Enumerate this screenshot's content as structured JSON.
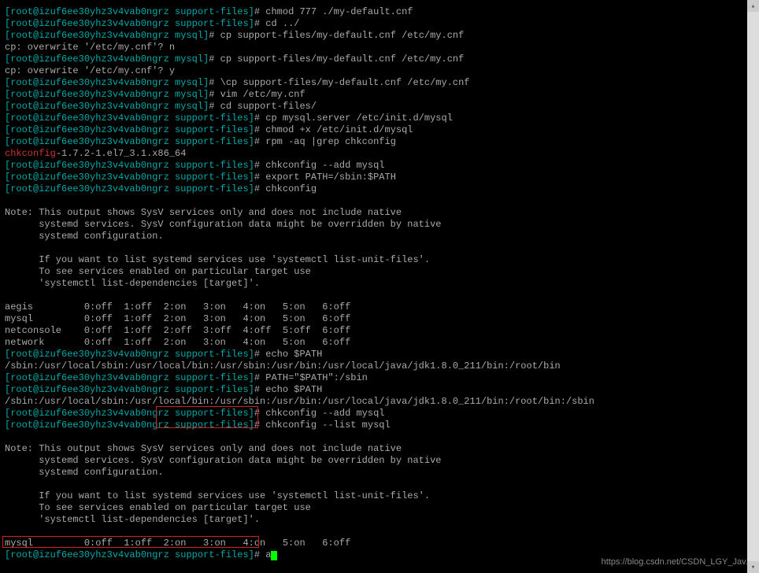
{
  "host": "izuf6ee30yhz3v4vab0ngrz",
  "user": "root",
  "lines": [
    {
      "t": "p",
      "dir": "support-files",
      "c": "chmod 777 ./my-default.cnf"
    },
    {
      "t": "p",
      "dir": "support-files",
      "c": "cd ../"
    },
    {
      "t": "p",
      "dir": "mysql",
      "c": "cp support-files/my-default.cnf /etc/my.cnf"
    },
    {
      "t": "o",
      "text": "cp: overwrite '/etc/my.cnf'? n"
    },
    {
      "t": "p",
      "dir": "mysql",
      "c": "cp support-files/my-default.cnf /etc/my.cnf"
    },
    {
      "t": "o",
      "text": "cp: overwrite '/etc/my.cnf'? y"
    },
    {
      "t": "p",
      "dir": "mysql",
      "c": "\\cp support-files/my-default.cnf /etc/my.cnf"
    },
    {
      "t": "p",
      "dir": "mysql",
      "c": "vim /etc/my.cnf"
    },
    {
      "t": "p",
      "dir": "mysql",
      "c": "cd support-files/"
    },
    {
      "t": "p",
      "dir": "support-files",
      "c": "cp mysql.server /etc/init.d/mysql"
    },
    {
      "t": "p",
      "dir": "support-files",
      "c": "chmod +x /etc/init.d/mysql"
    },
    {
      "t": "p",
      "dir": "support-files",
      "c": "rpm -aq |grep chkconfig"
    },
    {
      "t": "pkg",
      "name": "chkconfig",
      "rest": "-1.7.2-1.el7_3.1.x86_64"
    },
    {
      "t": "p",
      "dir": "support-files",
      "c": "chkconfig --add mysql"
    },
    {
      "t": "p",
      "dir": "support-files",
      "c": "export PATH=/sbin:$PATH"
    },
    {
      "t": "p",
      "dir": "support-files",
      "c": "chkconfig"
    },
    {
      "t": "blank"
    },
    {
      "t": "o",
      "text": "Note: This output shows SysV services only and does not include native"
    },
    {
      "t": "o",
      "text": "      systemd services. SysV configuration data might be overridden by native"
    },
    {
      "t": "o",
      "text": "      systemd configuration."
    },
    {
      "t": "blank"
    },
    {
      "t": "o",
      "text": "      If you want to list systemd services use 'systemctl list-unit-files'."
    },
    {
      "t": "o",
      "text": "      To see services enabled on particular target use"
    },
    {
      "t": "o",
      "text": "      'systemctl list-dependencies [target]'."
    },
    {
      "t": "blank"
    },
    {
      "t": "svc",
      "name": "aegis",
      "lv": [
        "0:off",
        "1:off",
        "2:on",
        "3:on",
        "4:on",
        "5:on",
        "6:off"
      ]
    },
    {
      "t": "svc",
      "name": "mysql",
      "lv": [
        "0:off",
        "1:off",
        "2:on",
        "3:on",
        "4:on",
        "5:on",
        "6:off"
      ]
    },
    {
      "t": "svc",
      "name": "netconsole",
      "lv": [
        "0:off",
        "1:off",
        "2:off",
        "3:off",
        "4:off",
        "5:off",
        "6:off"
      ]
    },
    {
      "t": "svc",
      "name": "network",
      "lv": [
        "0:off",
        "1:off",
        "2:on",
        "3:on",
        "4:on",
        "5:on",
        "6:off"
      ]
    },
    {
      "t": "p",
      "dir": "support-files",
      "c": "echo $PATH"
    },
    {
      "t": "o",
      "text": "/sbin:/usr/local/sbin:/usr/local/bin:/usr/sbin:/usr/bin:/usr/local/java/jdk1.8.0_211/bin:/root/bin"
    },
    {
      "t": "p",
      "dir": "support-files",
      "c": "PATH=\"$PATH\":/sbin"
    },
    {
      "t": "p",
      "dir": "support-files",
      "c": "echo $PATH"
    },
    {
      "t": "o",
      "text": "/sbin:/usr/local/sbin:/usr/local/bin:/usr/sbin:/usr/bin:/usr/local/java/jdk1.8.0_211/bin:/root/bin:/sbin"
    },
    {
      "t": "p",
      "dir": "support-files",
      "c": "chkconfig --add mysql"
    },
    {
      "t": "p",
      "dir": "support-files",
      "c": "chkconfig --list mysql"
    },
    {
      "t": "blank"
    },
    {
      "t": "o",
      "text": "Note: This output shows SysV services only and does not include native"
    },
    {
      "t": "o",
      "text": "      systemd services. SysV configuration data might be overridden by native"
    },
    {
      "t": "o",
      "text": "      systemd configuration."
    },
    {
      "t": "blank"
    },
    {
      "t": "o",
      "text": "      If you want to list systemd services use 'systemctl list-unit-files'."
    },
    {
      "t": "o",
      "text": "      To see services enabled on particular target use"
    },
    {
      "t": "o",
      "text": "      'systemctl list-dependencies [target]'."
    },
    {
      "t": "blank"
    },
    {
      "t": "svc",
      "name": "mysql",
      "lv": [
        "0:off",
        "1:off",
        "2:on",
        "3:on",
        "4:on",
        "5:on",
        "6:off"
      ]
    },
    {
      "t": "pc",
      "dir": "support-files",
      "c": "a"
    }
  ],
  "watermark": "https://blog.csdn.net/CSDN_LGY_Jav..."
}
